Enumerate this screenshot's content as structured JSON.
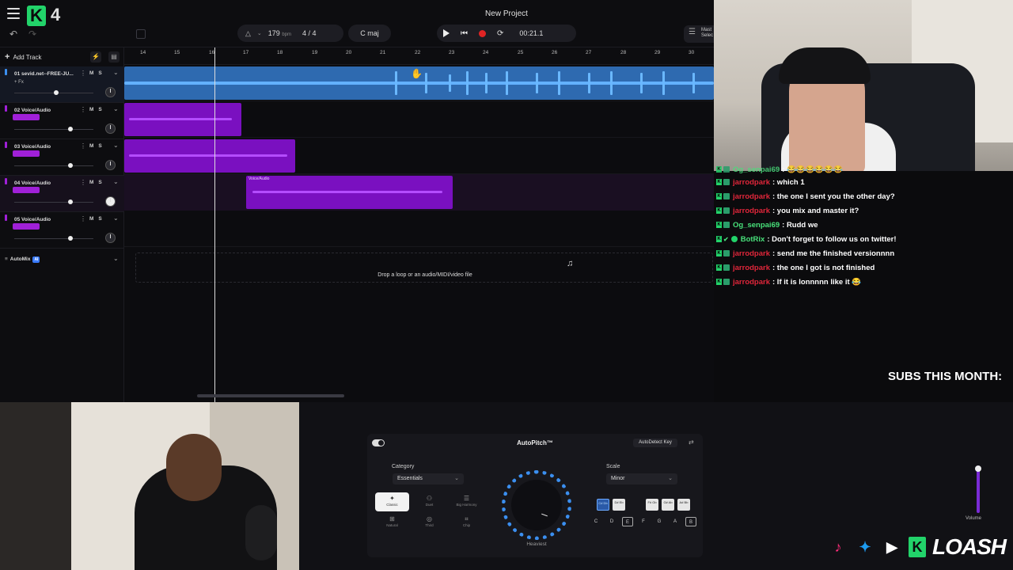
{
  "app": {
    "version": "4",
    "project_title": "New Project"
  },
  "toolbar": {
    "tempo": "179",
    "tempo_unit": "bpm",
    "time_signature": "4 / 4",
    "key": "C maj",
    "time": "00:21.1",
    "master_label": "Mast Selec"
  },
  "track_panel": {
    "add_track": "Add Track",
    "automix": "AutoMix",
    "automix_badge": "AI"
  },
  "tracks": [
    {
      "name": "01  sevid.net--FREE-JU...",
      "sub": "+ Fx",
      "color": "#3b8ff0"
    },
    {
      "name": "02  Voice/Audio",
      "color": "#a020d8"
    },
    {
      "name": "03  Voice/Audio",
      "color": "#a020d8"
    },
    {
      "name": "04  Voice/Audio",
      "color": "#a020d8"
    },
    {
      "name": "05  Voice/Audio",
      "color": "#a020d8"
    }
  ],
  "ruler": [
    "14",
    "15",
    "16",
    "17",
    "18",
    "19",
    "20",
    "21",
    "22",
    "23",
    "24",
    "25",
    "26",
    "27",
    "28",
    "29",
    "30"
  ],
  "clips": {
    "track4_label": "Voice/Audio"
  },
  "drop_zone": {
    "text": "Drop a loop or an audio/MIDI/video file"
  },
  "autopitch": {
    "title": "AutoPitch™",
    "autodetect": "AutoDetect Key",
    "category_label": "Category",
    "category_value": "Essentials",
    "presets": [
      "Classic",
      "Duet",
      "Big Harmony",
      "Natural",
      "Third",
      "Chip"
    ],
    "selected_preset": "Classic",
    "dial_caption": "Heaviest",
    "scale_label": "Scale",
    "scale_value": "Minor",
    "black_keys": [
      "C#\nDb",
      "D#\nEb",
      "F#\nGb",
      "G#\nAb",
      "A#\nBb"
    ],
    "white_keys": [
      "C",
      "D",
      "E",
      "F",
      "G",
      "A",
      "B"
    ],
    "volume_label": "Volume"
  },
  "chat": [
    {
      "user": "Og_senpai69",
      "msg": ": 😂😂😂😂😂😂",
      "color": "green",
      "partial": true
    },
    {
      "user": "jarrodpark",
      "msg": ": which 1",
      "color": "red"
    },
    {
      "user": "jarrodpark",
      "msg": ": the one I sent you the other day?",
      "color": "red"
    },
    {
      "user": "jarrodpark",
      "msg": ": you mix and master it?",
      "color": "red"
    },
    {
      "user": "Og_senpai69",
      "msg": ": Rudd we",
      "color": "green"
    },
    {
      "user": "BotRix",
      "msg": ": Don't forget to follow us on twitter!",
      "color": "green"
    },
    {
      "user": "jarrodpark",
      "msg": ": send me the finished versionnnn",
      "color": "red"
    },
    {
      "user": "jarrodpark",
      "msg": ": the one I got is not finished",
      "color": "red"
    },
    {
      "user": "jarrodpark",
      "msg": ": If it is lonnnnn like it 😂",
      "color": "red"
    }
  ],
  "overlay": {
    "subs": "SUBS THIS MONTH:",
    "brand": "LOASH"
  }
}
